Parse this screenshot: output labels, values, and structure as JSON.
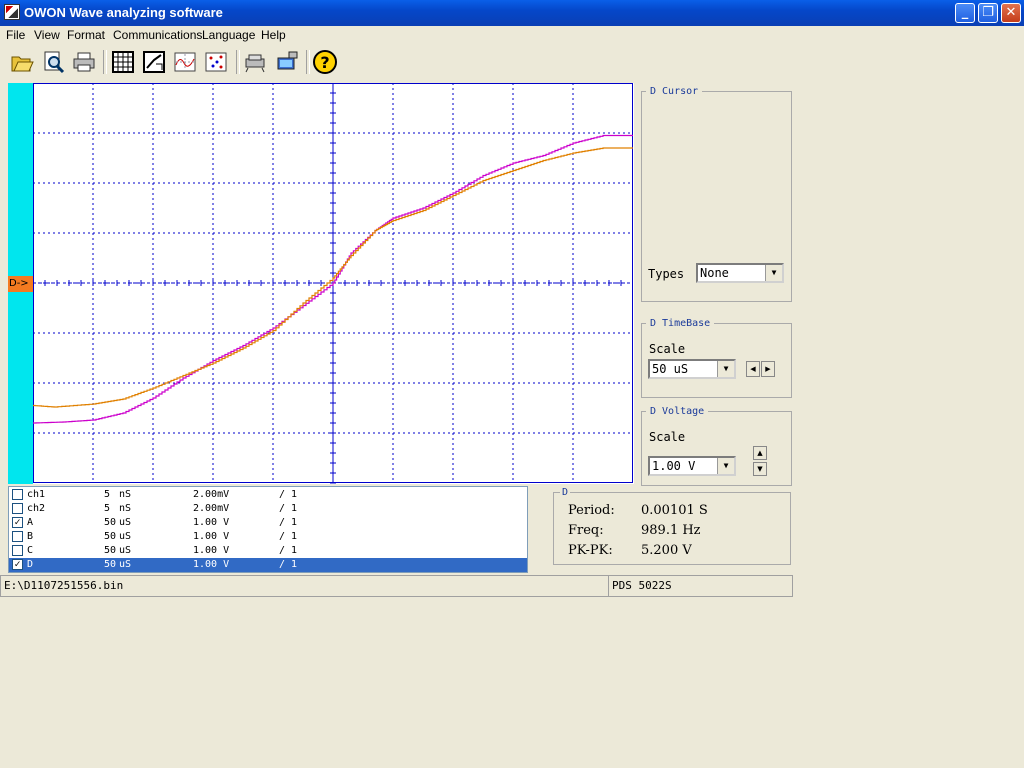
{
  "window": {
    "title": "OWON Wave analyzing software"
  },
  "menu": [
    "File",
    "View",
    "Format",
    "Communications",
    "Language",
    "Help"
  ],
  "toolbar": {
    "icons": [
      "open-folder-icon",
      "print-preview-icon",
      "print-icon",
      "calculator-icon",
      "zoom-icon",
      "waveform-icon",
      "scatter-icon",
      "connect-device-icon",
      "computer-transfer-icon",
      "help-icon"
    ]
  },
  "scope": {
    "marker_label": "D->",
    "background": "#ffffff",
    "grid_color": "#0000cc",
    "left_bar_color": "#00e6ee",
    "trace_colors": {
      "magenta": "#cc00cc",
      "orange": "#e08000"
    }
  },
  "chart_data": {
    "type": "line",
    "xlim": [
      0,
      10
    ],
    "ylim": [
      -4,
      4
    ],
    "grid": true,
    "series": [
      {
        "color": "#cc00cc",
        "values": [
          [
            0,
            -2.8
          ],
          [
            0.5,
            -2.78
          ],
          [
            1,
            -2.74
          ],
          [
            1.5,
            -2.6
          ],
          [
            2,
            -2.3
          ],
          [
            2.5,
            -1.9
          ],
          [
            3,
            -1.55
          ],
          [
            3.5,
            -1.25
          ],
          [
            4,
            -0.9
          ],
          [
            4.5,
            -0.45
          ],
          [
            5,
            0
          ],
          [
            5.3,
            0.6
          ],
          [
            5.7,
            1.05
          ],
          [
            6,
            1.3
          ],
          [
            6.5,
            1.5
          ],
          [
            7,
            1.8
          ],
          [
            7.5,
            2.15
          ],
          [
            8,
            2.4
          ],
          [
            8.5,
            2.55
          ],
          [
            9,
            2.8
          ],
          [
            9.5,
            2.95
          ],
          [
            10,
            2.95
          ]
        ]
      },
      {
        "color": "#e08000",
        "values": [
          [
            0,
            -2.45
          ],
          [
            0.35,
            -2.48
          ],
          [
            1,
            -2.42
          ],
          [
            1.5,
            -2.32
          ],
          [
            2,
            -2.1
          ],
          [
            2.5,
            -1.85
          ],
          [
            3,
            -1.6
          ],
          [
            3.5,
            -1.3
          ],
          [
            4,
            -0.95
          ],
          [
            4.5,
            -0.4
          ],
          [
            5,
            0.1
          ],
          [
            5.3,
            0.55
          ],
          [
            5.7,
            1.05
          ],
          [
            6,
            1.25
          ],
          [
            6.5,
            1.45
          ],
          [
            7,
            1.75
          ],
          [
            7.5,
            2.05
          ],
          [
            8,
            2.25
          ],
          [
            8.5,
            2.45
          ],
          [
            9,
            2.6
          ],
          [
            9.5,
            2.7
          ],
          [
            10,
            2.7
          ]
        ]
      }
    ]
  },
  "cursor_panel": {
    "legend": "D   Cursor",
    "types_label": "Types",
    "types_value": "None"
  },
  "timebase_panel": {
    "legend": "D   TimeBase",
    "scale_label": "Scale",
    "scale_value": "50 uS"
  },
  "voltage_panel": {
    "legend": "D   Voltage",
    "scale_label": "Scale",
    "scale_value": "1.00 V"
  },
  "channels": [
    {
      "checked": false,
      "name": "ch1",
      "a": "5",
      "b": "nS",
      "volt": "2.00mV",
      "ratio": "/ 1",
      "selected": false
    },
    {
      "checked": false,
      "name": "ch2",
      "a": "5",
      "b": "nS",
      "volt": "2.00mV",
      "ratio": "/ 1",
      "selected": false
    },
    {
      "checked": true,
      "name": "A",
      "a": "50",
      "b": "uS",
      "volt": "1.00 V",
      "ratio": "/ 1",
      "selected": false
    },
    {
      "checked": false,
      "name": "B",
      "a": "50",
      "b": "uS",
      "volt": "1.00 V",
      "ratio": "/ 1",
      "selected": false
    },
    {
      "checked": false,
      "name": "C",
      "a": "50",
      "b": "uS",
      "volt": "1.00 V",
      "ratio": "/ 1",
      "selected": false
    },
    {
      "checked": true,
      "name": "D",
      "a": "50",
      "b": "uS",
      "volt": "1.00 V",
      "ratio": "/ 1",
      "selected": true
    }
  ],
  "measure": {
    "legend": "D",
    "period_label": "Period:",
    "period_value": "0.00101 S",
    "freq_label": "Freq:",
    "freq_value": "989.1 Hz",
    "pkpk_label": "PK-PK:",
    "pkpk_value": "5.200 V"
  },
  "status": {
    "file": "E:\\D1107251556.bin",
    "device": "PDS 5022S"
  }
}
